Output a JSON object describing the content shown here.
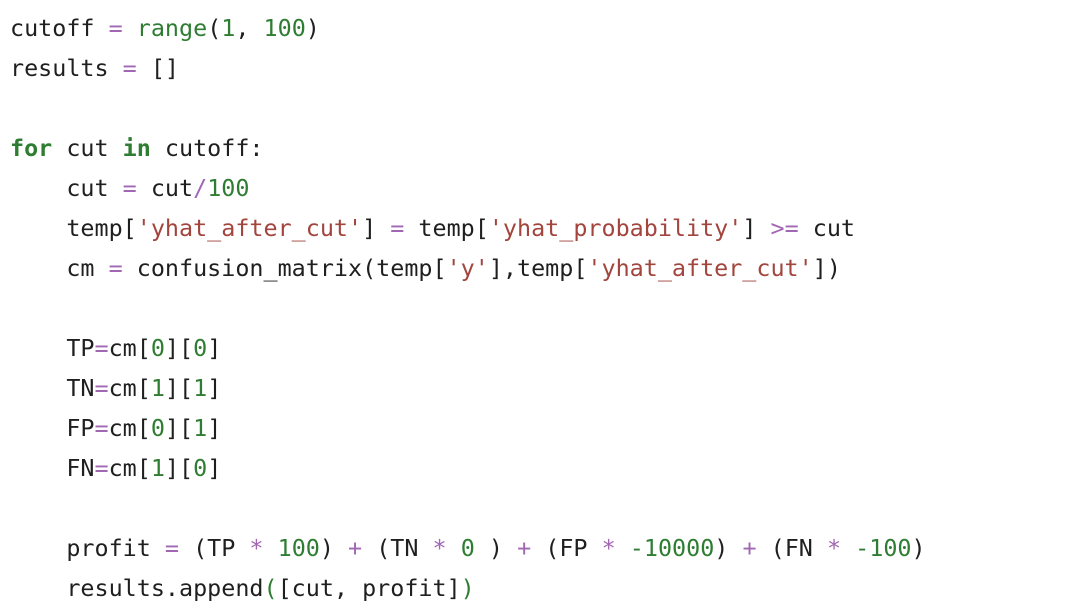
{
  "code": {
    "language": "python",
    "colors": {
      "plain": "#1f1f1f",
      "operator": "#a167b3",
      "number": "#2e7d32",
      "string": "#a1453d",
      "keyword": "#2e7d32",
      "builtin": "#2e7d32",
      "background": "#ffffff"
    },
    "lines": [
      {
        "tokens": [
          {
            "t": "cutoff ",
            "k": "plain"
          },
          {
            "t": "=",
            "k": "op"
          },
          {
            "t": " ",
            "k": "plain"
          },
          {
            "t": "range",
            "k": "fn"
          },
          {
            "t": "(",
            "k": "plain"
          },
          {
            "t": "1",
            "k": "num"
          },
          {
            "t": ", ",
            "k": "plain"
          },
          {
            "t": "100",
            "k": "num"
          },
          {
            "t": ")",
            "k": "plain"
          }
        ]
      },
      {
        "tokens": [
          {
            "t": "results ",
            "k": "plain"
          },
          {
            "t": "=",
            "k": "op"
          },
          {
            "t": " []",
            "k": "plain"
          }
        ]
      },
      {
        "tokens": []
      },
      {
        "tokens": [
          {
            "t": "for",
            "k": "kw"
          },
          {
            "t": " cut ",
            "k": "plain"
          },
          {
            "t": "in",
            "k": "kw"
          },
          {
            "t": " cutoff:",
            "k": "plain"
          }
        ]
      },
      {
        "tokens": [
          {
            "t": "    cut ",
            "k": "plain"
          },
          {
            "t": "=",
            "k": "op"
          },
          {
            "t": " cut",
            "k": "plain"
          },
          {
            "t": "/",
            "k": "op"
          },
          {
            "t": "100",
            "k": "num"
          }
        ]
      },
      {
        "tokens": [
          {
            "t": "    temp[",
            "k": "plain"
          },
          {
            "t": "'yhat_after_cut'",
            "k": "str"
          },
          {
            "t": "] ",
            "k": "plain"
          },
          {
            "t": "=",
            "k": "op"
          },
          {
            "t": " temp[",
            "k": "plain"
          },
          {
            "t": "'yhat_probability'",
            "k": "str"
          },
          {
            "t": "] ",
            "k": "plain"
          },
          {
            "t": ">=",
            "k": "op"
          },
          {
            "t": " cut",
            "k": "plain"
          }
        ]
      },
      {
        "tokens": [
          {
            "t": "    cm ",
            "k": "plain"
          },
          {
            "t": "=",
            "k": "op"
          },
          {
            "t": " confusion_matrix(temp[",
            "k": "plain"
          },
          {
            "t": "'y'",
            "k": "str"
          },
          {
            "t": "],temp[",
            "k": "plain"
          },
          {
            "t": "'yhat_after_cut'",
            "k": "str"
          },
          {
            "t": "])",
            "k": "plain"
          }
        ]
      },
      {
        "tokens": []
      },
      {
        "tokens": [
          {
            "t": "    TP",
            "k": "plain"
          },
          {
            "t": "=",
            "k": "op"
          },
          {
            "t": "cm[",
            "k": "plain"
          },
          {
            "t": "0",
            "k": "num"
          },
          {
            "t": "][",
            "k": "plain"
          },
          {
            "t": "0",
            "k": "num"
          },
          {
            "t": "]",
            "k": "plain"
          }
        ]
      },
      {
        "tokens": [
          {
            "t": "    TN",
            "k": "plain"
          },
          {
            "t": "=",
            "k": "op"
          },
          {
            "t": "cm[",
            "k": "plain"
          },
          {
            "t": "1",
            "k": "num"
          },
          {
            "t": "][",
            "k": "plain"
          },
          {
            "t": "1",
            "k": "num"
          },
          {
            "t": "]",
            "k": "plain"
          }
        ]
      },
      {
        "tokens": [
          {
            "t": "    FP",
            "k": "plain"
          },
          {
            "t": "=",
            "k": "op"
          },
          {
            "t": "cm[",
            "k": "plain"
          },
          {
            "t": "0",
            "k": "num"
          },
          {
            "t": "][",
            "k": "plain"
          },
          {
            "t": "1",
            "k": "num"
          },
          {
            "t": "]",
            "k": "plain"
          }
        ]
      },
      {
        "tokens": [
          {
            "t": "    FN",
            "k": "plain"
          },
          {
            "t": "=",
            "k": "op"
          },
          {
            "t": "cm[",
            "k": "plain"
          },
          {
            "t": "1",
            "k": "num"
          },
          {
            "t": "][",
            "k": "plain"
          },
          {
            "t": "0",
            "k": "num"
          },
          {
            "t": "]",
            "k": "plain"
          }
        ]
      },
      {
        "tokens": []
      },
      {
        "tokens": [
          {
            "t": "    profit ",
            "k": "plain"
          },
          {
            "t": "=",
            "k": "op"
          },
          {
            "t": " (TP ",
            "k": "plain"
          },
          {
            "t": "*",
            "k": "op"
          },
          {
            "t": " ",
            "k": "plain"
          },
          {
            "t": "100",
            "k": "num"
          },
          {
            "t": ") ",
            "k": "plain"
          },
          {
            "t": "+",
            "k": "op"
          },
          {
            "t": " (TN ",
            "k": "plain"
          },
          {
            "t": "*",
            "k": "op"
          },
          {
            "t": " ",
            "k": "plain"
          },
          {
            "t": "0",
            "k": "num"
          },
          {
            "t": " ) ",
            "k": "plain"
          },
          {
            "t": "+",
            "k": "op"
          },
          {
            "t": " (FP ",
            "k": "plain"
          },
          {
            "t": "*",
            "k": "op"
          },
          {
            "t": " ",
            "k": "plain"
          },
          {
            "t": "-10000",
            "k": "num"
          },
          {
            "t": ") ",
            "k": "plain"
          },
          {
            "t": "+",
            "k": "op"
          },
          {
            "t": " (FN ",
            "k": "plain"
          },
          {
            "t": "*",
            "k": "op"
          },
          {
            "t": " ",
            "k": "plain"
          },
          {
            "t": "-100",
            "k": "num"
          },
          {
            "t": ")",
            "k": "plain"
          }
        ]
      },
      {
        "tokens": [
          {
            "t": "    results.append",
            "k": "plain"
          },
          {
            "t": "(",
            "k": "paren"
          },
          {
            "t": "[cut, profit]",
            "k": "plain"
          },
          {
            "t": ")",
            "k": "paren"
          }
        ]
      }
    ]
  }
}
